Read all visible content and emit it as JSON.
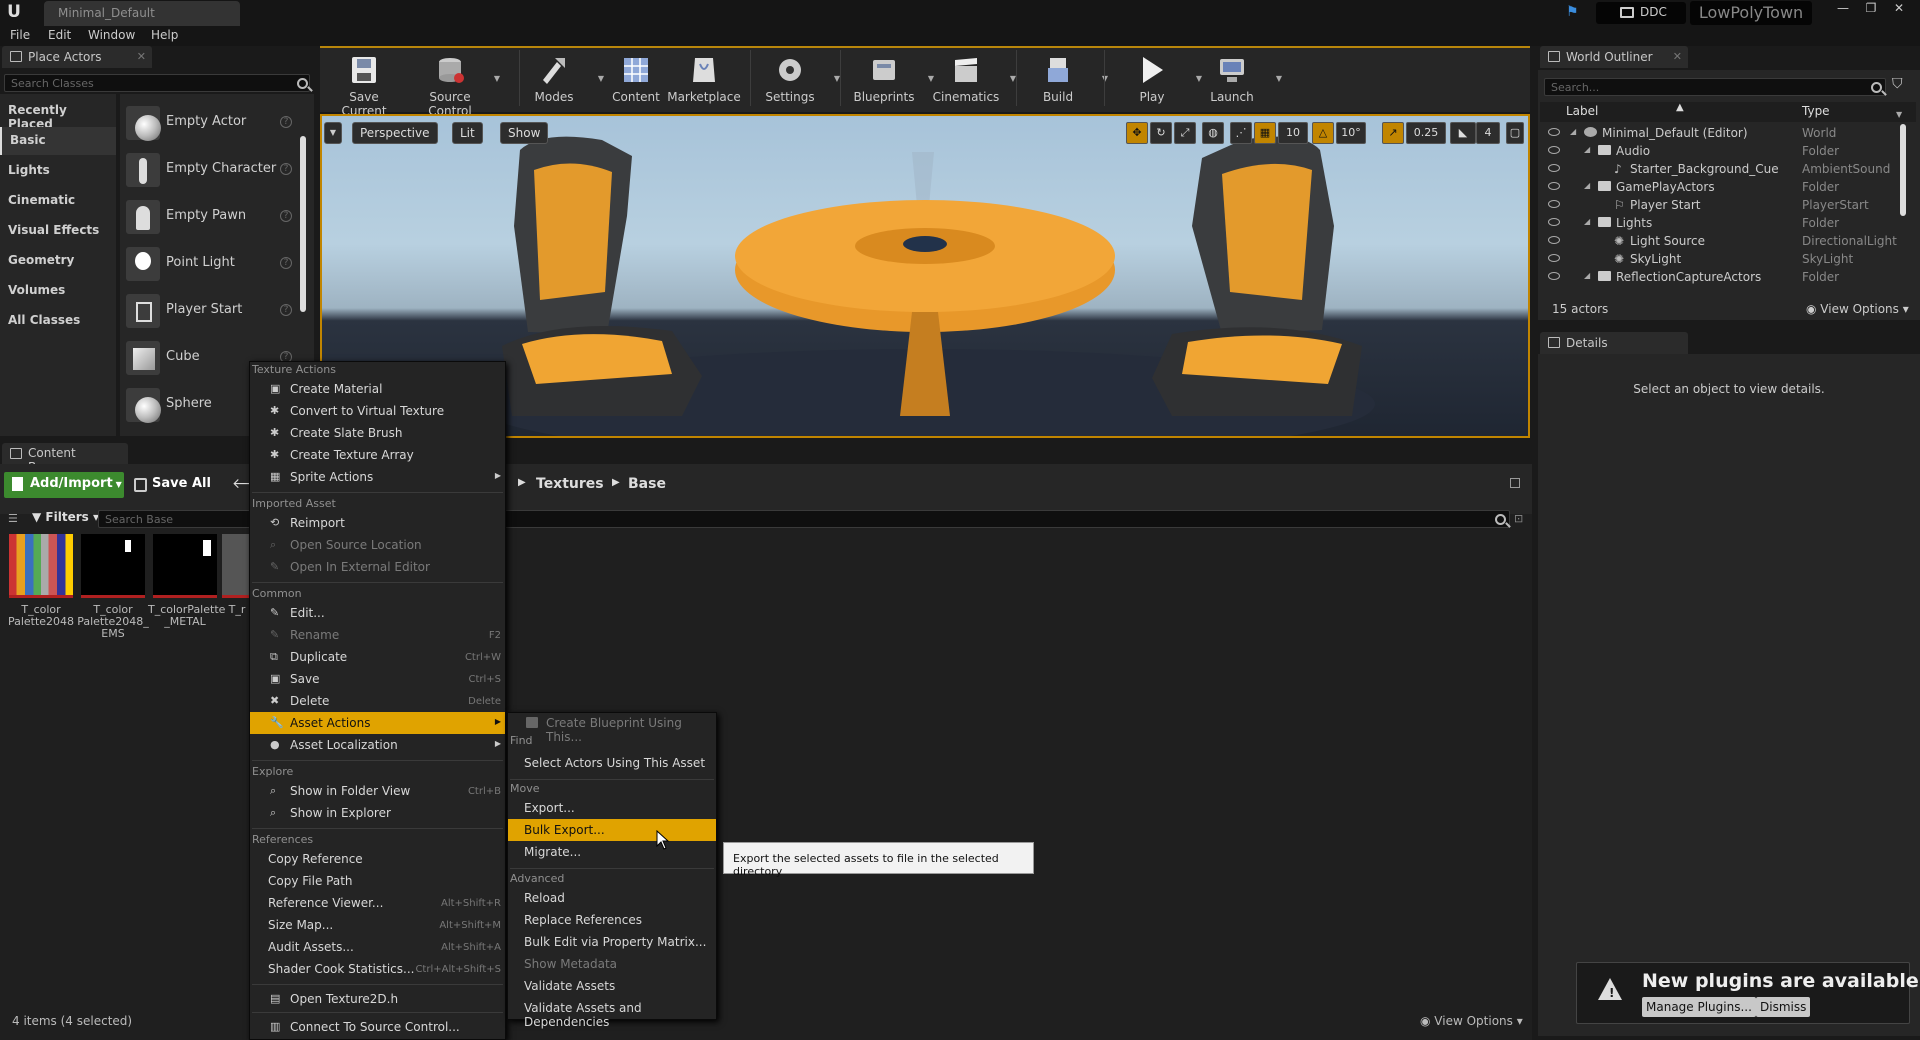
{
  "window": {
    "tab_title": "Minimal_Default",
    "ddc_label": "DDC",
    "project_name": "LowPolyTown"
  },
  "menu": [
    "File",
    "Edit",
    "Window",
    "Help"
  ],
  "place_actors": {
    "tab": "Place Actors",
    "search_placeholder": "Search Classes",
    "categories": [
      "Recently Placed",
      "Basic",
      "Lights",
      "Cinematic",
      "Visual Effects",
      "Geometry",
      "Volumes",
      "All Classes"
    ],
    "selected_category": "Basic",
    "items": [
      "Empty Actor",
      "Empty Character",
      "Empty Pawn",
      "Point Light",
      "Player Start",
      "Cube",
      "Sphere"
    ]
  },
  "toolbar": {
    "buttons": [
      "Save Current",
      "Source Control",
      "Modes",
      "Content",
      "Marketplace",
      "Settings",
      "Blueprints",
      "Cinematics",
      "Build",
      "Play",
      "Launch"
    ]
  },
  "viewport": {
    "perspective": "Perspective",
    "lit": "Lit",
    "show": "Show",
    "grid_snap": "10",
    "rot_snap": "10°",
    "scale_snap": "0.25",
    "cam_speed": "4"
  },
  "content_browser": {
    "tab": "Content Browser",
    "add_import": "Add/Import",
    "save_all": "Save All",
    "path": [
      "Textures",
      "Base"
    ],
    "filters": "Filters",
    "search_placeholder": "Search Base",
    "assets": [
      {
        "name": "T_color Palette2048"
      },
      {
        "name": "T_color Palette2048_ EMS"
      },
      {
        "name": "T_colorPalette _METAL"
      },
      {
        "name": "T_r"
      }
    ],
    "status": "4 items (4 selected)",
    "view_options": "View Options"
  },
  "outliner": {
    "tab": "World Outliner",
    "search_placeholder": "Search...",
    "col_label": "Label",
    "col_type": "Type",
    "rows": [
      {
        "label": "Minimal_Default (Editor)",
        "type": "World"
      },
      {
        "label": "Audio",
        "type": "Folder"
      },
      {
        "label": "Starter_Background_Cue",
        "type": "AmbientSound"
      },
      {
        "label": "GamePlayActors",
        "type": "Folder"
      },
      {
        "label": "Player Start",
        "type": "PlayerStart"
      },
      {
        "label": "Lights",
        "type": "Folder"
      },
      {
        "label": "Light Source",
        "type": "DirectionalLight"
      },
      {
        "label": "SkyLight",
        "type": "SkyLight"
      },
      {
        "label": "ReflectionCaptureActors",
        "type": "Folder"
      }
    ],
    "count": "15 actors",
    "view_options": "View Options"
  },
  "details": {
    "tab": "Details",
    "empty": "Select an object to view details."
  },
  "context_menu": {
    "sec_texture": "Texture Actions",
    "create_material": "Create Material",
    "convert_vt": "Convert to Virtual Texture",
    "create_slate": "Create Slate Brush",
    "create_tex_array": "Create Texture Array",
    "sprite_actions": "Sprite Actions",
    "sec_imported": "Imported Asset",
    "reimport": "Reimport",
    "open_source": "Open Source Location",
    "open_external": "Open In External Editor",
    "sec_common": "Common",
    "edit": "Edit...",
    "rename": "Rename",
    "rename_sc": "F2",
    "duplicate": "Duplicate",
    "duplicate_sc": "Ctrl+W",
    "save": "Save",
    "save_sc": "Ctrl+S",
    "delete": "Delete",
    "delete_sc": "Delete",
    "asset_actions": "Asset Actions",
    "asset_localization": "Asset Localization",
    "sec_explore": "Explore",
    "show_folder": "Show in Folder View",
    "show_folder_sc": "Ctrl+B",
    "show_explorer": "Show in Explorer",
    "sec_references": "References",
    "copy_ref": "Copy Reference",
    "copy_path": "Copy File Path",
    "ref_viewer": "Reference Viewer...",
    "ref_viewer_sc": "Alt+Shift+R",
    "size_map": "Size Map...",
    "size_map_sc": "Alt+Shift+M",
    "audit": "Audit Assets...",
    "audit_sc": "Alt+Shift+A",
    "shader_stats": "Shader Cook Statistics...",
    "shader_stats_sc": "Ctrl+Alt+Shift+S",
    "open_tex2d": "Open Texture2D.h",
    "connect_sc": "Connect To Source Control..."
  },
  "submenu": {
    "create_bp": "Create Blueprint Using This...",
    "sec_find": "Find",
    "select_actors": "Select Actors Using This Asset",
    "sec_move": "Move",
    "export": "Export...",
    "bulk_export": "Bulk Export...",
    "migrate": "Migrate...",
    "sec_advanced": "Advanced",
    "reload": "Reload",
    "replace_refs": "Replace References",
    "bulk_edit": "Bulk Edit via Property Matrix...",
    "show_metadata": "Show Metadata",
    "validate": "Validate Assets",
    "validate_deps": "Validate Assets and Dependencies"
  },
  "tooltip": "Export the selected assets to file in the selected directory",
  "notification": {
    "title": "New plugins are available",
    "manage": "Manage Plugins...",
    "dismiss": "Dismiss"
  }
}
